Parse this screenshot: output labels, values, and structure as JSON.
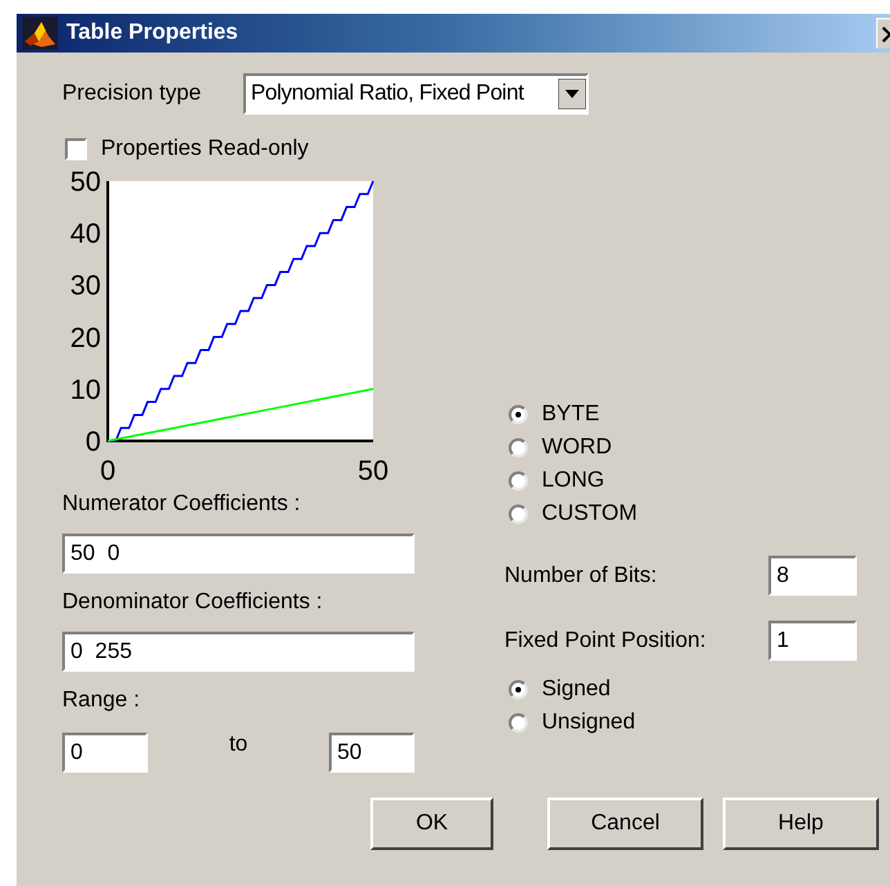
{
  "window": {
    "title": "Table Properties"
  },
  "precision": {
    "label": "Precision type",
    "value": "Polynomial Ratio, Fixed Point"
  },
  "read_only": {
    "label": "Properties Read-only",
    "checked": false
  },
  "plot": {
    "chart_data": {
      "type": "line",
      "x": [
        0,
        1.5,
        2.5,
        4,
        5,
        6.5,
        7.5,
        9,
        10,
        11.5,
        12.5,
        14,
        15,
        16.5,
        17.5,
        19,
        20,
        21.5,
        22.5,
        24,
        25,
        26.5,
        27.5,
        29,
        30,
        31.5,
        32.5,
        34,
        35,
        36.5,
        37.5,
        39,
        40,
        41.5,
        42.5,
        44,
        45,
        46.5,
        47.5,
        49,
        50
      ],
      "xlim": [
        0,
        50
      ],
      "ylim": [
        0,
        50
      ],
      "xticks": [
        0,
        50
      ],
      "yticks": [
        0,
        10,
        20,
        30,
        40,
        50
      ],
      "series": [
        {
          "color": "#0000ff",
          "values": [
            0,
            0,
            2.5,
            2.5,
            5,
            5,
            7.5,
            7.5,
            10,
            10,
            12.5,
            12.5,
            15,
            15,
            17.5,
            17.5,
            20,
            20,
            22.5,
            22.5,
            25,
            25,
            27.5,
            27.5,
            30,
            30,
            32.5,
            32.5,
            35,
            35,
            37.5,
            37.5,
            40,
            40,
            42.5,
            42.5,
            45,
            45,
            47.5,
            47.5,
            50
          ]
        },
        {
          "color": "#00ff00",
          "values": [
            0,
            0.3,
            0.5,
            0.8,
            1,
            1.3,
            1.5,
            1.8,
            2,
            2.3,
            2.5,
            2.8,
            3,
            3.3,
            3.5,
            3.8,
            4,
            4.3,
            4.5,
            4.8,
            5,
            5.3,
            5.5,
            5.8,
            6,
            6.3,
            6.5,
            6.8,
            7,
            7.3,
            7.5,
            7.8,
            8,
            8.3,
            8.5,
            8.8,
            9,
            9.3,
            9.5,
            9.8,
            10
          ]
        }
      ]
    }
  },
  "numerator": {
    "label": "Numerator Coefficients :",
    "value": "50  0"
  },
  "denominator": {
    "label": "Denominator Coefficients :",
    "value": "0  255"
  },
  "range": {
    "label": "Range :",
    "from": "0",
    "to_label": "to",
    "to": "50"
  },
  "word_size": [
    {
      "label": "BYTE",
      "selected": true
    },
    {
      "label": "WORD",
      "selected": false
    },
    {
      "label": "LONG",
      "selected": false
    },
    {
      "label": "CUSTOM",
      "selected": false
    }
  ],
  "bits": {
    "label": "Number of Bits:",
    "value": "8"
  },
  "fixed_point": {
    "label": "Fixed Point Position:",
    "value": "1"
  },
  "sign": [
    {
      "label": "Signed",
      "selected": true
    },
    {
      "label": "Unsigned",
      "selected": false
    }
  ],
  "buttons": [
    "OK",
    "Cancel",
    "Help"
  ]
}
